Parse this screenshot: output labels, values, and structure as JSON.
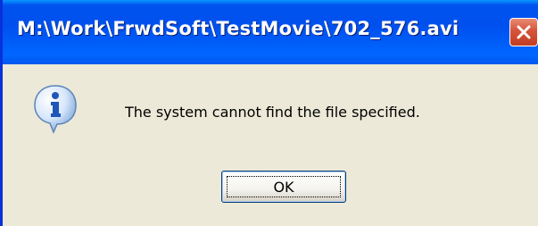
{
  "dialog": {
    "title": "M:\\Work\\FrwdSoft\\TestMovie\\702_576.avi",
    "message": "The system cannot find the file specified.",
    "icon": "information-icon",
    "buttons": {
      "ok_label": "OK"
    },
    "title_bar_controls": {
      "close_icon": "close-icon"
    }
  },
  "colors": {
    "title_bar": "#0054e3",
    "dialog_background": "#ece9d8",
    "close_button": "#d4543a",
    "title_text": "#ffffff"
  }
}
